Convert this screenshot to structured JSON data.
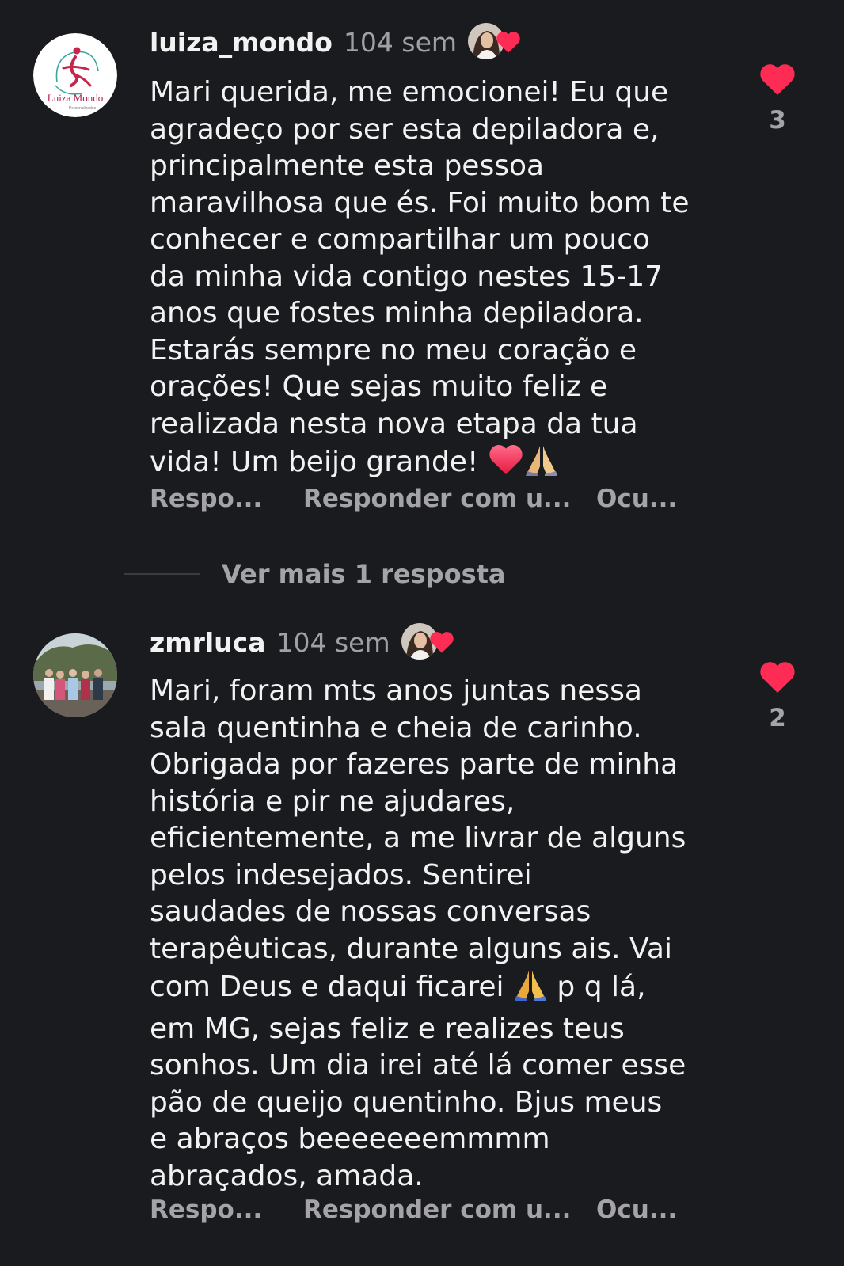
{
  "colors": {
    "background": "#1a1b1f",
    "text_primary": "#f2f2f2",
    "text_secondary": "#a3a3a8",
    "like_heart": "#fe2c55"
  },
  "comments": [
    {
      "username": "luiza_mondo",
      "time": "104 sem",
      "avatar_logo_text": "Luiza Mondo",
      "avatar_logo_subtext": "Personalizados",
      "text": "Mari querida, me emocionei! Eu que\nagradeço por ser esta depiladora e,\nprincipalmente esta pessoa\nmaravilhosa que és. Foi muito bom te\nconhecer e compartilhar um pouco\nda minha vida contigo nestes 15-17\nanos que fostes minha depiladora.\nEstarás sempre no meu coração e\norações! Que sejas muito feliz e\nrealizada nesta nova etapa da tua\nvida! Um beijo grande!",
      "emojis": [
        "heart-emoji",
        "praying-hands-emoji"
      ],
      "like_count": "3",
      "actions": [
        "Respo...",
        "Responder com u...",
        "Ocu..."
      ]
    },
    {
      "username": "zmrluca",
      "time": "104 sem",
      "text_before_emoji": "Mari, foram mts anos juntas nessa\nsala quentinha e cheia de carinho.\nObrigada por fazeres parte de minha\nhistória e pir ne ajudares,\neficientemente, a me livrar de alguns\npelos indesejados. Sentirei\nsaudades de nossas conversas\nterapêuticas, durante alguns ais. Vai\ncom Deus e daqui ficarei ",
      "text_after_emoji": " p q  lá,\nem MG, sejas feliz e realizes teus\nsonhos. Um dia irei até lá comer esse\npão de queijo quentinho. Bjus meus\ne abraços beeeeeeemmmm\nabraçados, amada.",
      "like_count": "2",
      "actions": [
        "Respo...",
        "Responder com u...",
        "Ocu..."
      ]
    }
  ],
  "more_replies": {
    "label": "Ver mais 1 resposta"
  }
}
